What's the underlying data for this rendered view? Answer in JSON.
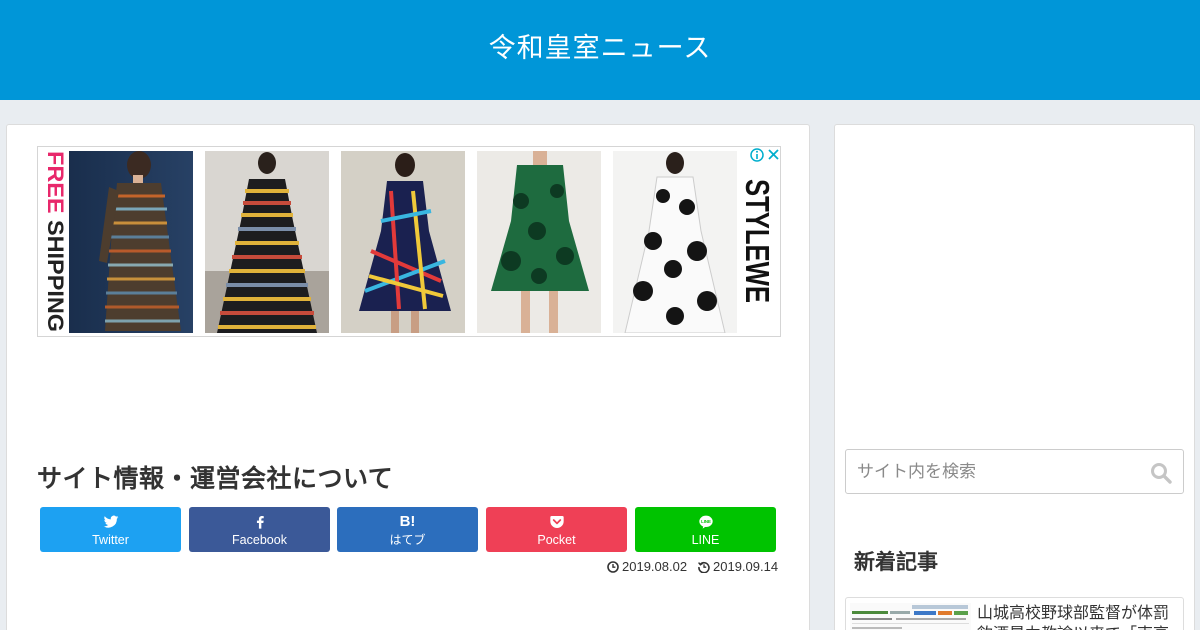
{
  "header": {
    "site_title": "令和皇室ニュース"
  },
  "ad": {
    "left_text": "FREE SHIPPING",
    "brand": "STYLEWE",
    "choices_icons": [
      "adchoices-info-icon",
      "ad-close-icon"
    ],
    "products": [
      "striped-coat-dress",
      "striped-maxi-dress",
      "plaid-midi-dress",
      "green-floral-shirt-dress",
      "white-floral-coat-dress"
    ]
  },
  "article": {
    "title": "サイト情報・運営会社について"
  },
  "share": {
    "twitter": {
      "label": "Twitter",
      "color": "#1da1f2",
      "icon": "twitter-bird-icon"
    },
    "facebook": {
      "label": "Facebook",
      "color": "#3b5998",
      "icon": "facebook-f-icon"
    },
    "hatebu": {
      "label": "はてブ",
      "glyph": "B!",
      "color": "#2c6ebd",
      "icon": "hatebu-icon"
    },
    "pocket": {
      "label": "Pocket",
      "color": "#ef4056",
      "icon": "pocket-icon"
    },
    "line": {
      "label": "LINE",
      "color": "#00c300",
      "icon": "line-icon"
    }
  },
  "meta": {
    "posted_date": "2019.08.02",
    "updated_date": "2019.09.14"
  },
  "sidebar": {
    "search_placeholder": "サイト内を検索",
    "new_posts_title": "新着記事",
    "new_posts": [
      {
        "title": "山城高校野球部監督が体罰飲酒暴力教諭以来で「売高"
      }
    ]
  },
  "colors": {
    "header_bg": "#0096d8",
    "page_bg": "#e9edf1"
  }
}
